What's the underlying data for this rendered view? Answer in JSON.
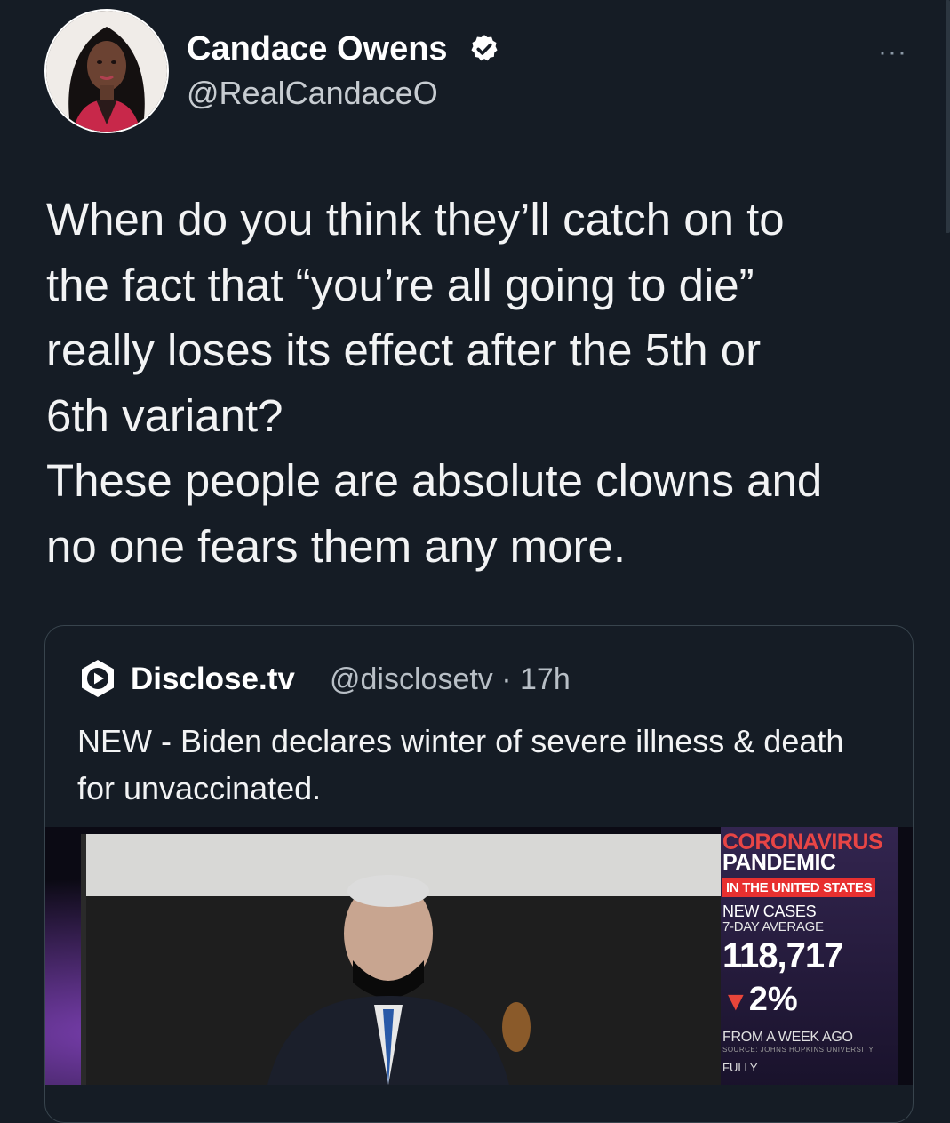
{
  "author": {
    "name": "Candace Owens",
    "handle": "@RealCandaceO",
    "verified_icon": "verified-badge-icon",
    "avatar_icon": "profile-photo"
  },
  "more_label": "···",
  "tweet": {
    "text": "When do you think they’ll catch on to\nthe fact that “you’re all going to die”\nreally loses its effect after the 5th or\n6th variant?\nThese people are absolute clowns and\nno one fears them any more."
  },
  "quoted": {
    "name": "Disclose.tv",
    "meta": "@disclosetv · 17h",
    "text": "NEW - Biden declares winter of severe illness & death for unvaccinated.",
    "media": {
      "chyron_title": "CORONAVIRUS",
      "chyron_subtitle": "PANDEMIC",
      "region": "IN THE UNITED STATES",
      "label": "NEW CASES",
      "sublabel": "7-DAY AVERAGE",
      "value": "118,717",
      "change": "2%",
      "change_suffix": "FROM A WEEK AGO",
      "source": "SOURCE: JOHNS HOPKINS UNIVERSITY",
      "next_label": "FULLY"
    }
  },
  "colors": {
    "background": "#151c25",
    "accent_red": "#e84545",
    "verified": "#ffffff"
  }
}
